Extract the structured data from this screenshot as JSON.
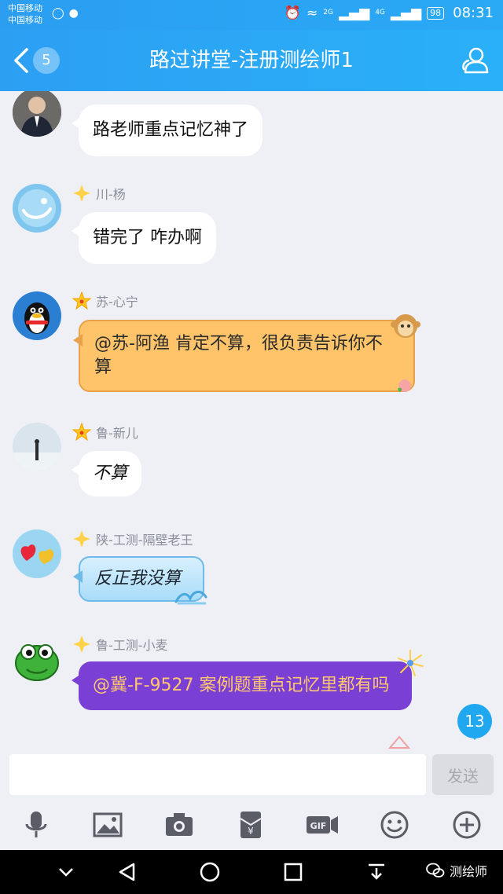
{
  "status_bar": {
    "carrier_1": "中国移动",
    "carrier_2": "中国移动",
    "sig_1": "2G",
    "sig_2": "4G",
    "battery": "98",
    "time": "08:31"
  },
  "header": {
    "unread_count": "5",
    "title": "路过讲堂-注册测绘师1"
  },
  "messages": [
    {
      "sender": "",
      "text": "路老师重点记忆神了",
      "style": "plain"
    },
    {
      "sender": "川-杨",
      "text": "错完了 咋办啊",
      "style": "plain"
    },
    {
      "sender": "苏-心宁",
      "text": "@苏-阿渔 肯定不算，很负责告诉你不算",
      "style": "orange"
    },
    {
      "sender": "鲁-新儿",
      "text": "不算",
      "style": "plain-script"
    },
    {
      "sender": "陕-工测-隔壁老王",
      "text": "反正我没算",
      "style": "blue"
    },
    {
      "sender": "鲁-工测-小麦",
      "text": "@冀-F-9527 案例题重点记忆里都有吗",
      "style": "purple"
    }
  ],
  "new_message_count": "13",
  "composer": {
    "placeholder": "",
    "send_label": "发送"
  },
  "toolbar": [
    "mic-icon",
    "image-icon",
    "camera-icon",
    "red-packet-icon",
    "gif-icon",
    "emoji-icon",
    "plus-icon"
  ],
  "navbar": {
    "watermark": "测绘师"
  },
  "colors": {
    "accent": "#2aa9f5",
    "orange_bubble": "#ffc46a",
    "purple_bubble": "#7a40d6",
    "badge": "#1fa7f0"
  }
}
